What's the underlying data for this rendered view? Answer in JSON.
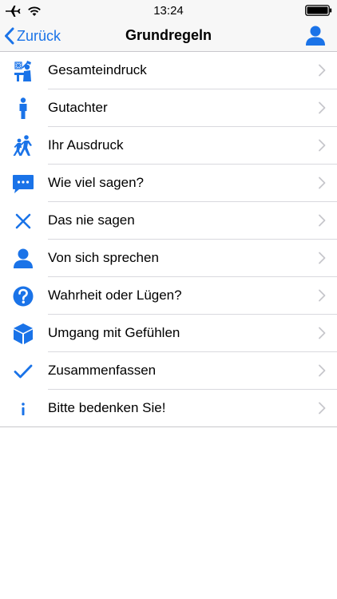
{
  "status_bar": {
    "time": "13:24"
  },
  "nav": {
    "back_label": "Zurück",
    "title": "Grundregeln"
  },
  "menu": {
    "items": [
      {
        "label": "Gesamteindruck",
        "icon": "presenter-icon"
      },
      {
        "label": "Gutachter",
        "icon": "person-standing-icon"
      },
      {
        "label": "Ihr Ausdruck",
        "icon": "walking-people-icon"
      },
      {
        "label": "Wie viel sagen?",
        "icon": "speech-bubble-icon"
      },
      {
        "label": "Das nie sagen",
        "icon": "cross-icon"
      },
      {
        "label": "Von sich sprechen",
        "icon": "user-icon"
      },
      {
        "label": "Wahrheit oder Lügen?",
        "icon": "question-circle-icon"
      },
      {
        "label": "Umgang mit Gefühlen",
        "icon": "cube-icon"
      },
      {
        "label": "Zusammenfassen",
        "icon": "checkmark-icon"
      },
      {
        "label": "Bitte bedenken Sie!",
        "icon": "info-icon"
      }
    ]
  },
  "colors": {
    "accent": "#1a73e8",
    "separator": "#d9d9de",
    "chevron": "#c7c7cc"
  }
}
